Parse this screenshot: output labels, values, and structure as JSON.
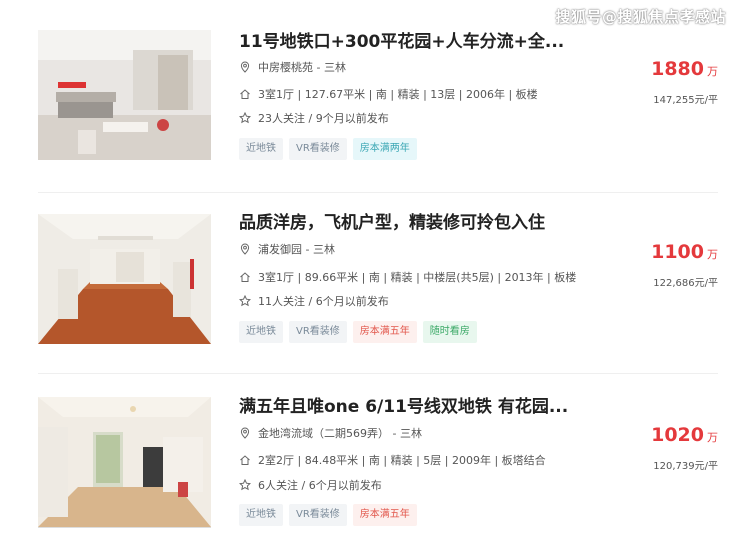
{
  "watermark": "搜狐号@搜狐焦点孝感站",
  "listings": [
    {
      "title": "11号地铁口+300平花园+人车分流+全...",
      "community": "中房樱桃苑",
      "district": "三林",
      "details": "3室1厅 | 127.67平米 | 南 | 精装 | 13层 | 2006年 | 板楼",
      "followers": "23人关注 / 9个月以前发布",
      "price": "1880",
      "price_unit": "万",
      "unit_price": "147,255元/平",
      "tags": [
        {
          "label": "近地铁",
          "style": "gray"
        },
        {
          "label": "VR看装修",
          "style": "gray"
        },
        {
          "label": "房本满两年",
          "style": "teal"
        }
      ]
    },
    {
      "title": "品质洋房，飞机户型，精装修可拎包入住",
      "community": "浦发御园",
      "district": "三林",
      "details": "3室1厅 | 89.66平米 | 南 | 精装 | 中楼层(共5层) | 2013年 | 板楼",
      "followers": "11人关注 / 6个月以前发布",
      "price": "1100",
      "price_unit": "万",
      "unit_price": "122,686元/平",
      "tags": [
        {
          "label": "近地铁",
          "style": "gray"
        },
        {
          "label": "VR看装修",
          "style": "gray"
        },
        {
          "label": "房本满五年",
          "style": "red"
        },
        {
          "label": "随时看房",
          "style": "green"
        }
      ]
    },
    {
      "title": "满五年且唯one 6/11号线双地铁 有花园...",
      "community": "金地湾流域（二期569弄）",
      "district": "三林",
      "details": "2室2厅 | 84.48平米 | 南 | 精装 | 5层 | 2009年 | 板塔结合",
      "followers": "6人关注 / 6个月以前发布",
      "price": "1020",
      "price_unit": "万",
      "unit_price": "120,739元/平",
      "tags": [
        {
          "label": "近地铁",
          "style": "gray"
        },
        {
          "label": "VR看装修",
          "style": "gray"
        },
        {
          "label": "房本满五年",
          "style": "red"
        }
      ]
    }
  ],
  "icons": {
    "location": "location-pin-icon",
    "house": "house-icon",
    "star": "star-icon"
  },
  "colors": {
    "price": "#e4393c",
    "tag_gray_bg": "#f2f4f6",
    "tag_teal_bg": "#e6f7fa",
    "tag_red_bg": "#fdf0ee",
    "tag_green_bg": "#e8f7ee"
  }
}
